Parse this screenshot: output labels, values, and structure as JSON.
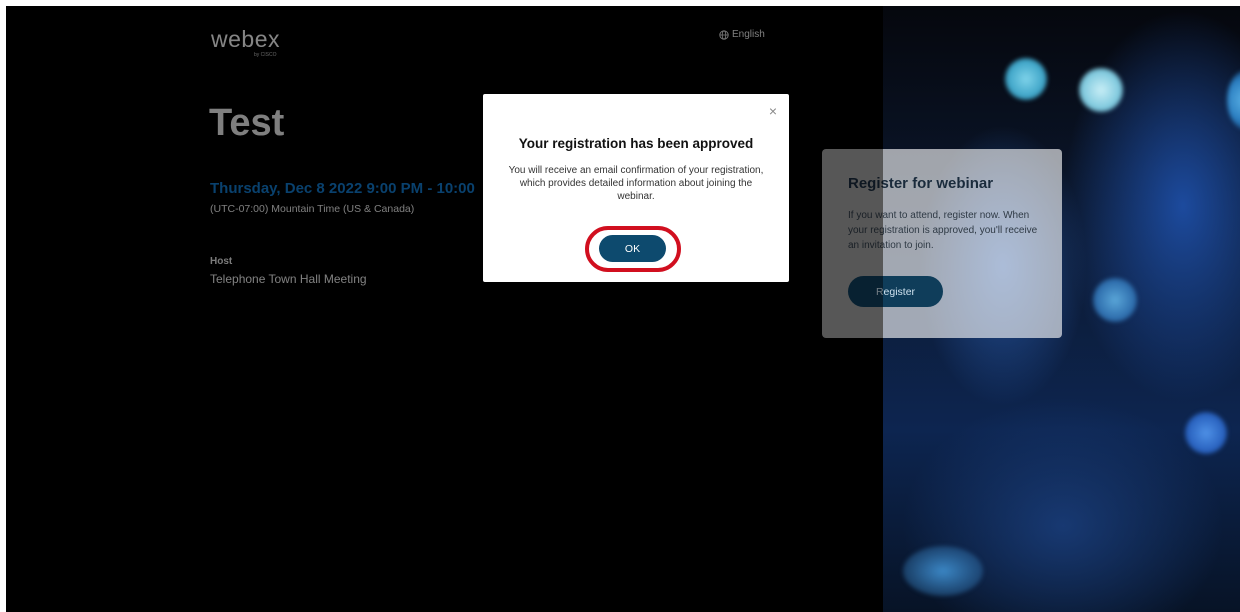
{
  "header": {
    "logo_text": "webex",
    "logo_sub": "by CISCO",
    "language_label": "English"
  },
  "event": {
    "title": "Test",
    "datetime": "Thursday, Dec 8 2022 9:00 PM - 10:00",
    "timezone": "(UTC-07:00) Mountain Time (US & Canada)",
    "host_label": "Host",
    "host_name": "Telephone Town Hall Meeting"
  },
  "register_card": {
    "title": "Register for webinar",
    "description": "If you want to attend, register now. When your registration is approved, you'll receive an invitation to join.",
    "button_label": "Register"
  },
  "modal": {
    "close_glyph": "×",
    "title": "Your registration has been approved",
    "body": "You will receive an email confirmation of your registration, which provides detailed information about joining the webinar.",
    "ok_label": "OK"
  },
  "colors": {
    "accent_blue": "#1277c8",
    "button_dark": "#0d4a6e",
    "highlight_red": "#d10f1f"
  }
}
